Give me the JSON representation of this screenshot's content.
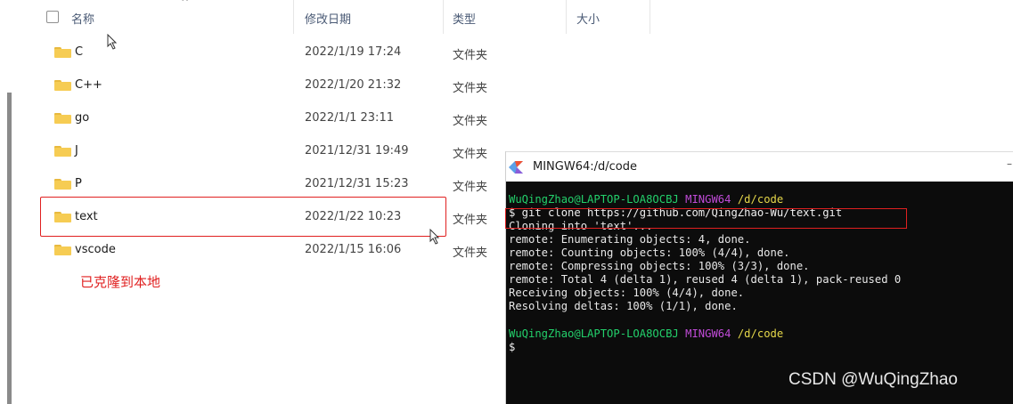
{
  "explorer": {
    "columns": {
      "name": "名称",
      "date_modified": "修改日期",
      "type": "类型",
      "size": "大小"
    },
    "rows": [
      {
        "name": "C",
        "date": "2022/1/19 17:24",
        "type": "文件夹"
      },
      {
        "name": "C++",
        "date": "2022/1/20 21:32",
        "type": "文件夹"
      },
      {
        "name": "go",
        "date": "2022/1/1 23:11",
        "type": "文件夹"
      },
      {
        "name": "J",
        "date": "2021/12/31 19:49",
        "type": "文件夹"
      },
      {
        "name": "P",
        "date": "2021/12/31 15:23",
        "type": "文件夹"
      },
      {
        "name": "text",
        "date": "2022/1/22 10:23",
        "type": "文件夹"
      },
      {
        "name": "vscode",
        "date": "2022/1/15 16:06",
        "type": "文件夹"
      }
    ],
    "annotation": "已克隆到本地",
    "colors": {
      "folder": "#f6cc53",
      "highlight": "#e02020"
    }
  },
  "terminal": {
    "title": "MINGW64:/d/code",
    "icon": "git-bash-icon",
    "prompt1": {
      "user": "WuQingZhao@LAPTOP-LOA8OCBJ",
      "env": "MINGW64",
      "path": "/d/code"
    },
    "command": "$ git clone https://github.com/QingZhao-Wu/text.git",
    "output": [
      "Cloning into 'text'...",
      "remote: Enumerating objects: 4, done.",
      "remote: Counting objects: 100% (4/4), done.",
      "remote: Compressing objects: 100% (3/3), done.",
      "remote: Total 4 (delta 1), reused 4 (delta 1), pack-reused 0",
      "Receiving objects: 100% (4/4), done.",
      "Resolving deltas: 100% (1/1), done."
    ],
    "prompt2": {
      "user": "WuQingZhao@LAPTOP-LOA8OCBJ",
      "env": "MINGW64",
      "path": "/d/code"
    },
    "cursor_line": "$",
    "colors": {
      "background": "#0c0c0c",
      "user": "#23d06b",
      "env": "#c04bd8",
      "path": "#e6d84a"
    }
  },
  "watermark": "CSDN @WuQingZhao"
}
